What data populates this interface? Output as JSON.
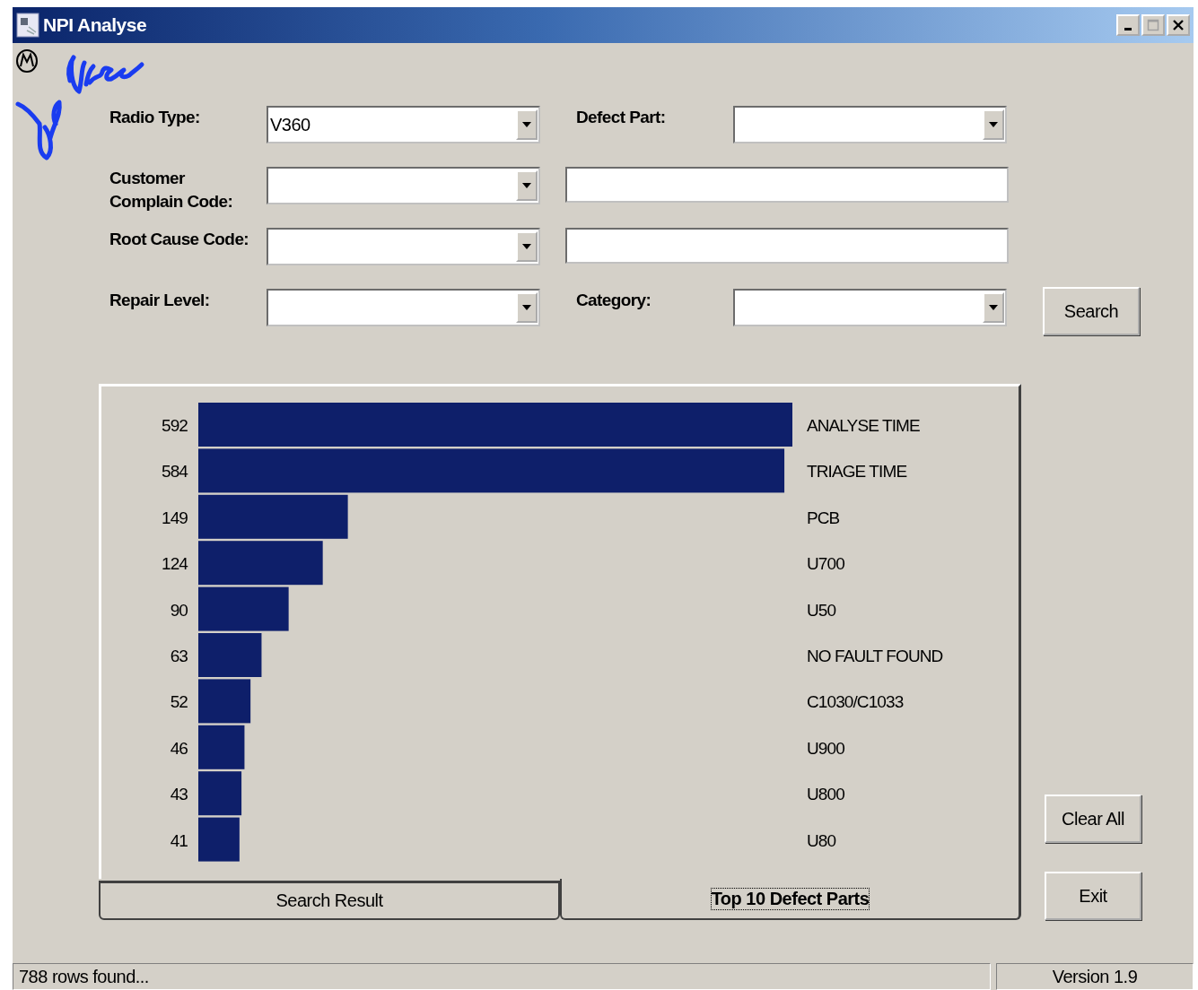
{
  "window": {
    "title": "NPI Analyse"
  },
  "form": {
    "rows": [
      {
        "cells": [
          {
            "kind": "label",
            "text": "Radio Type:"
          },
          {
            "kind": "combo",
            "value": "V360"
          },
          {
            "kind": "label",
            "text": "Defect Part:"
          },
          {
            "kind": "combo"
          }
        ]
      },
      {
        "cells": [
          {
            "kind": "label",
            "text": "Customer\nComplain Code:"
          },
          {
            "kind": "combo"
          },
          {
            "kind": "text"
          }
        ]
      },
      {
        "cells": [
          {
            "kind": "label",
            "text": "Root Cause Code:"
          },
          {
            "kind": "combo"
          },
          {
            "kind": "text"
          }
        ]
      },
      {
        "cells": [
          {
            "kind": "label",
            "text": "Repair Level:"
          },
          {
            "kind": "combo"
          },
          {
            "kind": "label",
            "text": "Category:"
          },
          {
            "kind": "combo"
          },
          {
            "kind": "button",
            "text": "Search"
          }
        ]
      }
    ]
  },
  "chart_data": {
    "type": "bar",
    "orientation": "horizontal",
    "data_labels": true,
    "categories": [
      "ANALYSE TIME",
      "TRIAGE TIME",
      "PCB",
      "U700",
      "U50",
      "NO FAULT FOUND",
      "C1030/C1033",
      "U900",
      "U800",
      "U80"
    ],
    "values": [
      592,
      584,
      149,
      124,
      90,
      63,
      52,
      46,
      43,
      41
    ]
  },
  "tabs": [
    {
      "label": "Search Result",
      "selected": false
    },
    {
      "label": "Top 10 Defect Parts",
      "selected": true
    }
  ],
  "side_buttons": [
    "Clear All",
    "Exit"
  ],
  "status_bar": {
    "message": "788 rows found...",
    "version": "Version 1.9"
  }
}
